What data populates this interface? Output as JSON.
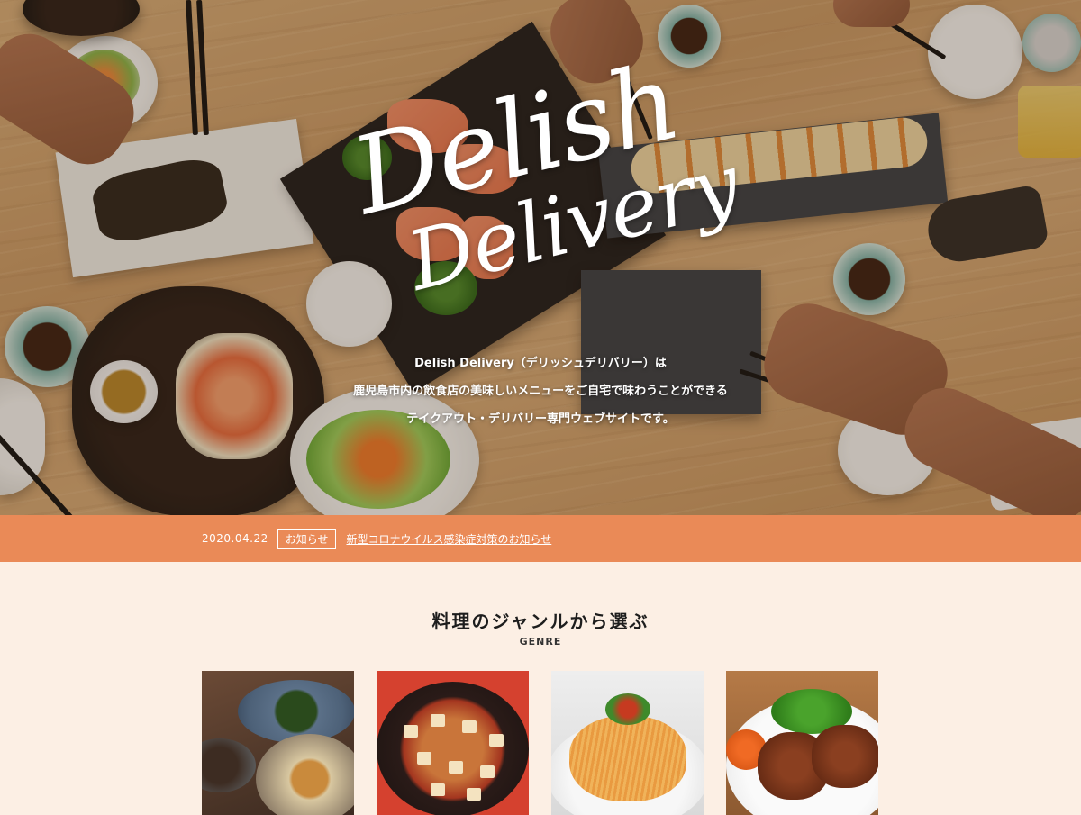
{
  "hero": {
    "logo_line1": "Delish",
    "logo_line2": "Delivery",
    "copy": [
      "Delish Delivery（デリッシュデリバリー）は",
      "鹿児島市内の飲食店の美味しいメニューをご自宅で味わうことができる",
      "テイクアウト・デリバリー専門ウェブサイトです。"
    ]
  },
  "news": {
    "date": "2020.04.22",
    "badge": "お知らせ",
    "title": "新型コロナウイルス感染症対策のお知らせ"
  },
  "genre": {
    "title": "料理のジャンルから選ぶ",
    "subtitle": "GENRE"
  },
  "colors": {
    "accent": "#ea8a57",
    "section_bg": "#fcefe4"
  }
}
